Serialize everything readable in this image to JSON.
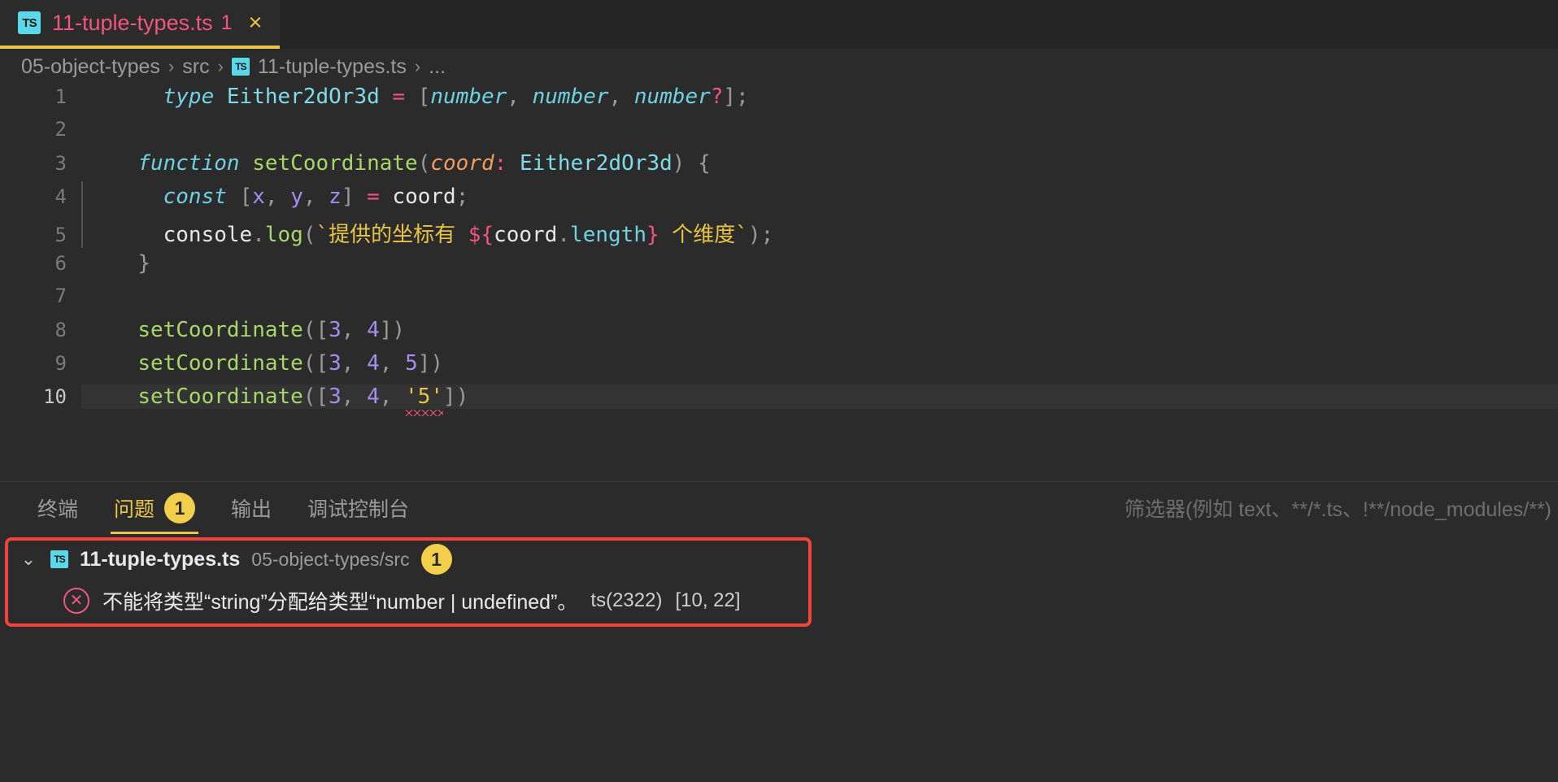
{
  "tab": {
    "icon": "typescript-file-icon",
    "icon_text": "TS",
    "label": "11-tuple-types.ts",
    "error_count": "1",
    "close": "×"
  },
  "breadcrumb": {
    "items": [
      "05-object-types",
      "src",
      "11-tuple-types.ts",
      "..."
    ],
    "separator": "›",
    "icon_text": "TS"
  },
  "editor": {
    "lines": [
      {
        "number": "1",
        "active": false,
        "tokens": [
          {
            "t": "    ",
            "c": "t-plain"
          },
          {
            "t": "type",
            "c": "t-key"
          },
          {
            "t": " ",
            "c": "t-plain"
          },
          {
            "t": "Either2dOr3d",
            "c": "t-type"
          },
          {
            "t": " ",
            "c": "t-plain"
          },
          {
            "t": "=",
            "c": "t-op"
          },
          {
            "t": " ",
            "c": "t-plain"
          },
          {
            "t": "[",
            "c": "t-punct"
          },
          {
            "t": "number",
            "c": "t-key"
          },
          {
            "t": ", ",
            "c": "t-punct"
          },
          {
            "t": "number",
            "c": "t-key"
          },
          {
            "t": ", ",
            "c": "t-punct"
          },
          {
            "t": "number",
            "c": "t-key"
          },
          {
            "t": "?",
            "c": "t-op"
          },
          {
            "t": "]",
            "c": "t-punct"
          },
          {
            "t": ";",
            "c": "t-punct"
          }
        ]
      },
      {
        "number": "2",
        "active": false,
        "tokens": []
      },
      {
        "number": "3",
        "active": false,
        "tokens": [
          {
            "t": "  ",
            "c": "t-plain"
          },
          {
            "t": "function",
            "c": "t-key"
          },
          {
            "t": " ",
            "c": "t-plain"
          },
          {
            "t": "setCoordinate",
            "c": "t-func"
          },
          {
            "t": "(",
            "c": "t-punct"
          },
          {
            "t": "coord",
            "c": "t-param"
          },
          {
            "t": ":",
            "c": "t-op"
          },
          {
            "t": " ",
            "c": "t-plain"
          },
          {
            "t": "Either2dOr3d",
            "c": "t-type"
          },
          {
            "t": ")",
            "c": "t-punct"
          },
          {
            "t": " ",
            "c": "t-plain"
          },
          {
            "t": "{",
            "c": "t-punct"
          }
        ]
      },
      {
        "number": "4",
        "active": false,
        "guide": true,
        "tokens": [
          {
            "t": "    ",
            "c": "t-plain"
          },
          {
            "t": "const",
            "c": "t-key"
          },
          {
            "t": " ",
            "c": "t-plain"
          },
          {
            "t": "[",
            "c": "t-punct"
          },
          {
            "t": "x",
            "c": "t-var"
          },
          {
            "t": ", ",
            "c": "t-punct"
          },
          {
            "t": "y",
            "c": "t-var"
          },
          {
            "t": ", ",
            "c": "t-punct"
          },
          {
            "t": "z",
            "c": "t-var"
          },
          {
            "t": "]",
            "c": "t-punct"
          },
          {
            "t": " ",
            "c": "t-plain"
          },
          {
            "t": "=",
            "c": "t-op"
          },
          {
            "t": " ",
            "c": "t-plain"
          },
          {
            "t": "coord",
            "c": "t-plain"
          },
          {
            "t": ";",
            "c": "t-punct"
          }
        ]
      },
      {
        "number": "5",
        "active": false,
        "guide": true,
        "tokens": [
          {
            "t": "    ",
            "c": "t-plain"
          },
          {
            "t": "console",
            "c": "t-plain"
          },
          {
            "t": ".",
            "c": "t-punct"
          },
          {
            "t": "log",
            "c": "t-func"
          },
          {
            "t": "(",
            "c": "t-punct"
          },
          {
            "t": "`提供的坐标有 ",
            "c": "t-tpl"
          },
          {
            "t": "${",
            "c": "t-op"
          },
          {
            "t": "coord",
            "c": "t-plain"
          },
          {
            "t": ".",
            "c": "t-punct"
          },
          {
            "t": "length",
            "c": "t-prop"
          },
          {
            "t": "}",
            "c": "t-op"
          },
          {
            "t": " 个维度`",
            "c": "t-tpl"
          },
          {
            "t": ")",
            "c": "t-punct"
          },
          {
            "t": ";",
            "c": "t-punct"
          }
        ]
      },
      {
        "number": "6",
        "active": false,
        "tokens": [
          {
            "t": "  ",
            "c": "t-plain"
          },
          {
            "t": "}",
            "c": "t-punct"
          }
        ]
      },
      {
        "number": "7",
        "active": false,
        "tokens": []
      },
      {
        "number": "8",
        "active": false,
        "tokens": [
          {
            "t": "  ",
            "c": "t-plain"
          },
          {
            "t": "setCoordinate",
            "c": "t-func"
          },
          {
            "t": "(",
            "c": "t-punct"
          },
          {
            "t": "[",
            "c": "t-punct"
          },
          {
            "t": "3",
            "c": "t-num"
          },
          {
            "t": ", ",
            "c": "t-punct"
          },
          {
            "t": "4",
            "c": "t-num"
          },
          {
            "t": "]",
            "c": "t-punct"
          },
          {
            "t": ")",
            "c": "t-punct"
          }
        ]
      },
      {
        "number": "9",
        "active": false,
        "tokens": [
          {
            "t": "  ",
            "c": "t-plain"
          },
          {
            "t": "setCoordinate",
            "c": "t-func"
          },
          {
            "t": "(",
            "c": "t-punct"
          },
          {
            "t": "[",
            "c": "t-punct"
          },
          {
            "t": "3",
            "c": "t-num"
          },
          {
            "t": ", ",
            "c": "t-punct"
          },
          {
            "t": "4",
            "c": "t-num"
          },
          {
            "t": ", ",
            "c": "t-punct"
          },
          {
            "t": "5",
            "c": "t-num"
          },
          {
            "t": "]",
            "c": "t-punct"
          },
          {
            "t": ")",
            "c": "t-punct"
          }
        ]
      },
      {
        "number": "10",
        "active": true,
        "tokens": [
          {
            "t": "  ",
            "c": "t-plain"
          },
          {
            "t": "setCoordinate",
            "c": "t-func"
          },
          {
            "t": "(",
            "c": "t-punct"
          },
          {
            "t": "[",
            "c": "t-punct"
          },
          {
            "t": "3",
            "c": "t-num"
          },
          {
            "t": ", ",
            "c": "t-punct"
          },
          {
            "t": "4",
            "c": "t-num"
          },
          {
            "t": ", ",
            "c": "t-punct"
          },
          {
            "t": "'5'",
            "c": "t-str",
            "err": true
          },
          {
            "t": "]",
            "c": "t-punct"
          },
          {
            "t": ")",
            "c": "t-punct"
          }
        ]
      }
    ]
  },
  "panel": {
    "tabs": [
      {
        "label": "终端",
        "active": false,
        "badge": null
      },
      {
        "label": "问题",
        "active": true,
        "badge": "1"
      },
      {
        "label": "输出",
        "active": false,
        "badge": null
      },
      {
        "label": "调试控制台",
        "active": false,
        "badge": null
      }
    ],
    "filter_placeholder": "筛选器(例如 text、**/*.ts、!**/node_modules/**)",
    "problem_group": {
      "chevron": "⌄",
      "icon_text": "TS",
      "file": "11-tuple-types.ts",
      "path": "05-object-types/src",
      "count": "1",
      "error_icon": "✕",
      "message": "不能将类型“string”分配给类型“number | undefined”。",
      "code": "ts(2322)",
      "position": "[10, 22]"
    }
  },
  "colors": {
    "accent_yellow": "#e8c547",
    "error_red": "#f2443d",
    "tab_pink": "#f2557f",
    "ts_blue": "#5ad8e8",
    "background": "#2b2b2b"
  }
}
